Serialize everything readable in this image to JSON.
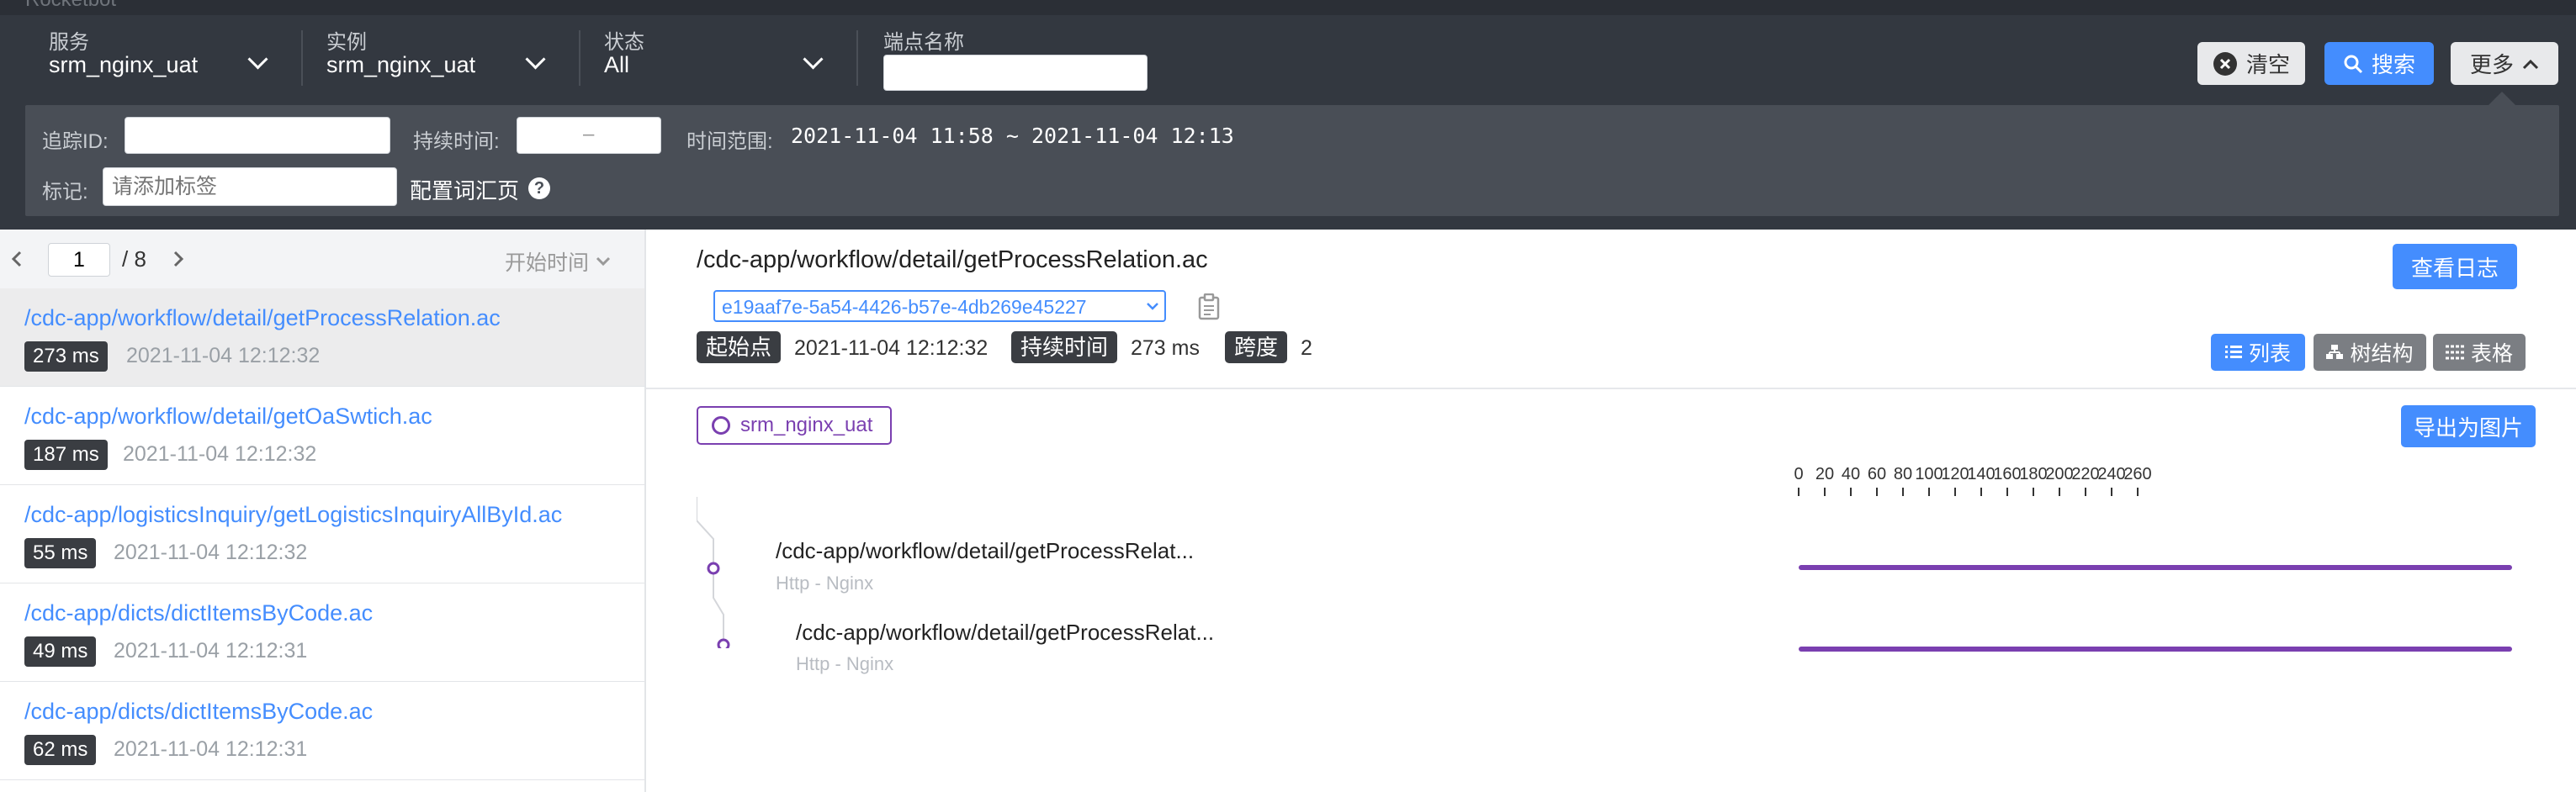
{
  "header": {
    "brand": "Rocketbot",
    "service": {
      "label": "服务",
      "value": "srm_nginx_uat"
    },
    "instance": {
      "label": "实例",
      "value": "srm_nginx_uat"
    },
    "status": {
      "label": "状态",
      "value": "All"
    },
    "endpoint": {
      "label": "端点名称",
      "value": ""
    },
    "buttons": {
      "clear": "清空",
      "search": "搜索",
      "more": "更多"
    },
    "advanced": {
      "trace_id_label": "追踪ID:",
      "trace_id_value": "",
      "duration_label": "持续时间:",
      "duration_sep": "–",
      "time_range_label": "时间范围:",
      "time_range_value": "2021-11-04 11:58 ~ 2021-11-04 12:13",
      "tags_label": "标记:",
      "tags_placeholder": "请添加标签",
      "config_label": "配置词汇页",
      "help_icon": "?"
    }
  },
  "pager": {
    "current": "1",
    "total": "/ 8",
    "sort_label": "开始时间"
  },
  "traces": [
    {
      "endpoint": "/cdc-app/workflow/detail/getProcessRelation.ac",
      "duration": "273 ms",
      "time": "2021-11-04 12:12:32"
    },
    {
      "endpoint": "/cdc-app/workflow/detail/getOaSwtich.ac",
      "duration": "187 ms",
      "time": "2021-11-04 12:12:32"
    },
    {
      "endpoint": "/cdc-app/logisticsInquiry/getLogisticsInquiryAllById.ac",
      "duration": "55 ms",
      "time": "2021-11-04 12:12:32"
    },
    {
      "endpoint": "/cdc-app/dicts/dictItemsByCode.ac",
      "duration": "49 ms",
      "time": "2021-11-04 12:12:31"
    },
    {
      "endpoint": "/cdc-app/dicts/dictItemsByCode.ac",
      "duration": "62 ms",
      "time": "2021-11-04 12:12:31"
    }
  ],
  "detail": {
    "title": "/cdc-app/workflow/detail/getProcessRelation.ac",
    "view_logs": "查看日志",
    "trace_id": "e19aaf7e-5a54-4426-b57e-4db269e45227",
    "start_label": "起始点",
    "start_value": "2021-11-04 12:12:32",
    "duration_label": "持续时间",
    "duration_value": "273 ms",
    "span_label": "跨度",
    "span_value": "2",
    "views": {
      "list": "列表",
      "tree": "树结构",
      "table": "表格"
    },
    "service_tag": "srm_nginx_uat",
    "export": "导出为图片",
    "axis_ticks": [
      "0",
      "20",
      "40",
      "60",
      "80",
      "100",
      "120",
      "140",
      "160",
      "180",
      "200",
      "220",
      "240",
      "260"
    ],
    "spans": [
      {
        "name": "/cdc-app/workflow/detail/getProcessRelat...",
        "sub": "Http - Nginx"
      },
      {
        "name": "/cdc-app/workflow/detail/getProcessRelat...",
        "sub": "Http - Nginx"
      }
    ],
    "colors": {
      "accent": "#448dfe",
      "span": "#7a3fb0",
      "badge": "#3a3d42"
    }
  }
}
